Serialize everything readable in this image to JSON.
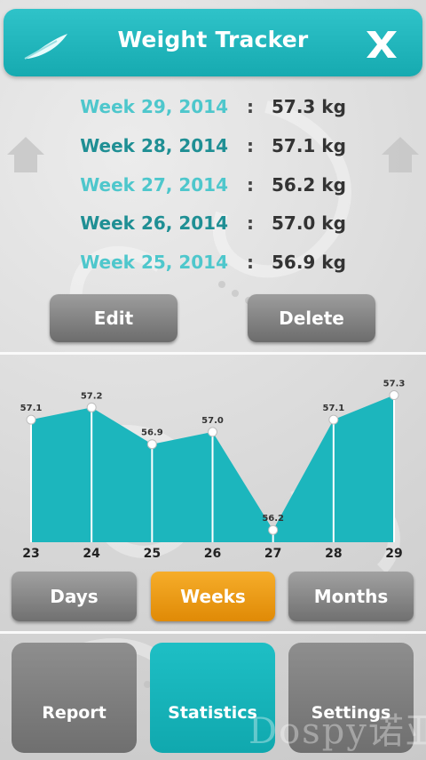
{
  "header": {
    "title": "Weight Tracker"
  },
  "entries": [
    {
      "week": "Week 29, 2014",
      "separator": ":",
      "weight": "57.3 kg",
      "color": "#4ec7cc"
    },
    {
      "week": "Week 28, 2014",
      "separator": ":",
      "weight": "57.1 kg",
      "color": "#1f8f94"
    },
    {
      "week": "Week 27, 2014",
      "separator": ":",
      "weight": "56.2 kg",
      "color": "#4ec7cc"
    },
    {
      "week": "Week 26, 2014",
      "separator": ":",
      "weight": "57.0 kg",
      "color": "#1f8f94"
    },
    {
      "week": "Week 25, 2014",
      "separator": ":",
      "weight": "56.9 kg",
      "color": "#4ec7cc"
    }
  ],
  "actions": {
    "edit": "Edit",
    "delete": "Delete"
  },
  "chart_data": {
    "type": "area",
    "categories": [
      "23",
      "24",
      "25",
      "26",
      "27",
      "28",
      "29"
    ],
    "values": [
      57.1,
      57.2,
      56.9,
      57.0,
      56.2,
      57.1,
      57.3
    ],
    "data_labels": [
      "57.1",
      "57.2",
      "56.9",
      "57.0",
      "56.2",
      "57.1",
      "57.3"
    ],
    "ylim": [
      56.1,
      57.42
    ],
    "fill_color": "#1cb6bd",
    "point_color": "#ffffff"
  },
  "period_tabs": {
    "days": "Days",
    "weeks": "Weeks",
    "months": "Months",
    "active": "Weeks"
  },
  "nav": {
    "report": "Report",
    "statistics": "Statistics",
    "settings": "Settings"
  },
  "watermark": "Dospy诺亚方舟",
  "colors": {
    "accent": "#1cb6bd",
    "active_tab": "#f0a020",
    "button": "#808080"
  }
}
